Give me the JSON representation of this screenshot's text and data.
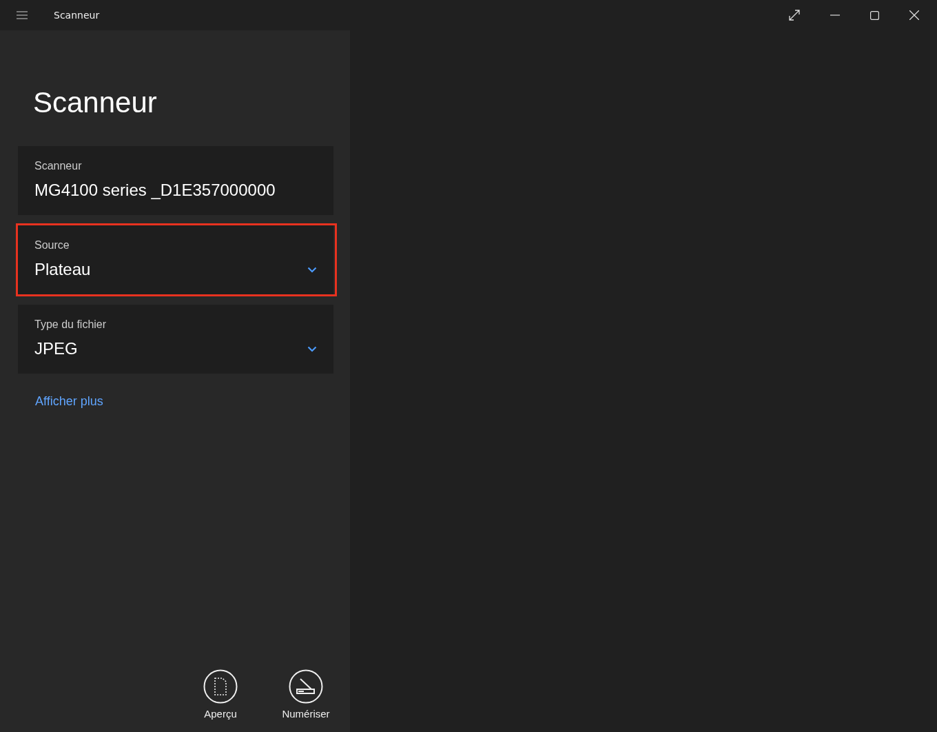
{
  "window": {
    "title": "Scanneur"
  },
  "heading": "Scanneur",
  "fields": [
    {
      "kind": "static",
      "label": "Scanneur",
      "value": "MG4100 series _D1E357000000",
      "highlighted": false
    },
    {
      "kind": "dropdown",
      "label": "Source",
      "value": "Plateau",
      "highlighted": true
    },
    {
      "kind": "dropdown",
      "label": "Type du fichier",
      "value": "JPEG",
      "highlighted": false
    }
  ],
  "more_link": "Afficher plus",
  "actions": [
    {
      "kind": "preview",
      "label": "Aperçu"
    },
    {
      "kind": "scan",
      "label": "Numériser"
    }
  ]
}
